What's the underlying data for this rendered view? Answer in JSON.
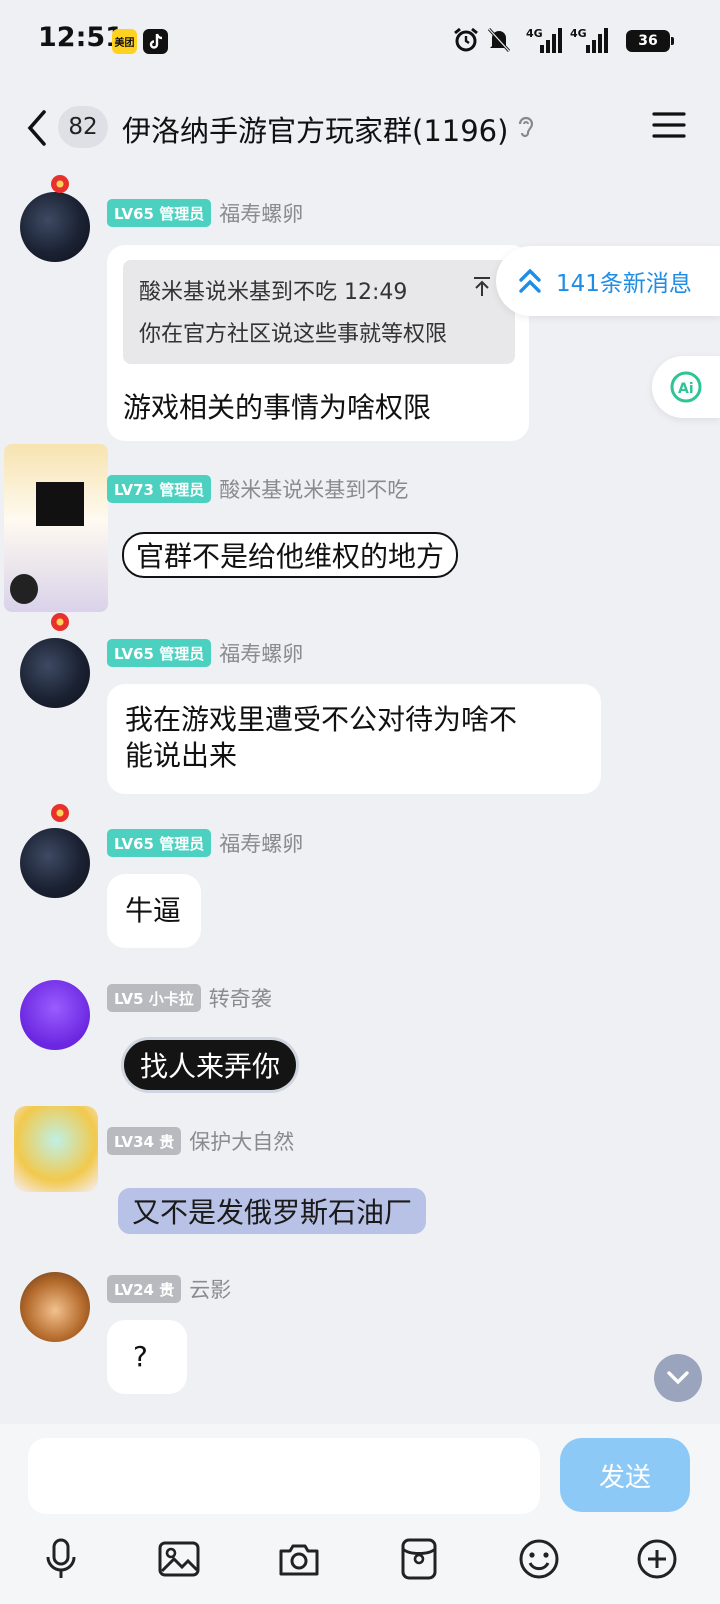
{
  "status_bar": {
    "time": "12:51",
    "app_icons": [
      "meituan-icon",
      "tiktok-icon"
    ],
    "meituan_label": "美团",
    "network_1": "4G",
    "network_2": "4G",
    "battery": "36"
  },
  "header": {
    "unread_count": "82",
    "title": "伊洛纳手游官方玩家群(1196)"
  },
  "floating": {
    "new_messages": "141条新消息"
  },
  "messages": [
    {
      "level": "LV65 管理员",
      "nick": "福寿螺卵",
      "quote_line1": "酸米基说米基到不吃 12:49",
      "quote_line2": "你在官方社区说这些事就等权限",
      "text": "游戏相关的事情为啥权限"
    },
    {
      "level": "LV73 管理员",
      "nick": "酸米基说米基到不吃",
      "text": "官群不是给他维权的地方"
    },
    {
      "level": "LV65 管理员",
      "nick": "福寿螺卵",
      "text_line1": "我在游戏里遭受不公对待为啥不",
      "text_line2": "能说出来"
    },
    {
      "level": "LV65 管理员",
      "nick": "福寿螺卵",
      "text": "牛逼"
    },
    {
      "level": "LV5 小卡拉",
      "nick": "转奇袭",
      "text": "找人来弄你"
    },
    {
      "level": "LV34 贵",
      "nick": "保护大自然",
      "text": "又不是发俄罗斯石油厂"
    },
    {
      "level": "LV24 贵",
      "nick": "云影",
      "text": "?"
    }
  ],
  "input": {
    "placeholder": "",
    "send_label": "发送"
  },
  "toolbar": [
    "microphone-icon",
    "image-icon",
    "camera-icon",
    "red-packet-icon",
    "emoji-icon",
    "plus-icon"
  ],
  "colors": {
    "background": "#eff0f4",
    "admin_badge": "#4cd0c0",
    "member_badge": "#b8bac0",
    "link_blue": "#1f8de6",
    "send_button": "#8cc9f6"
  }
}
